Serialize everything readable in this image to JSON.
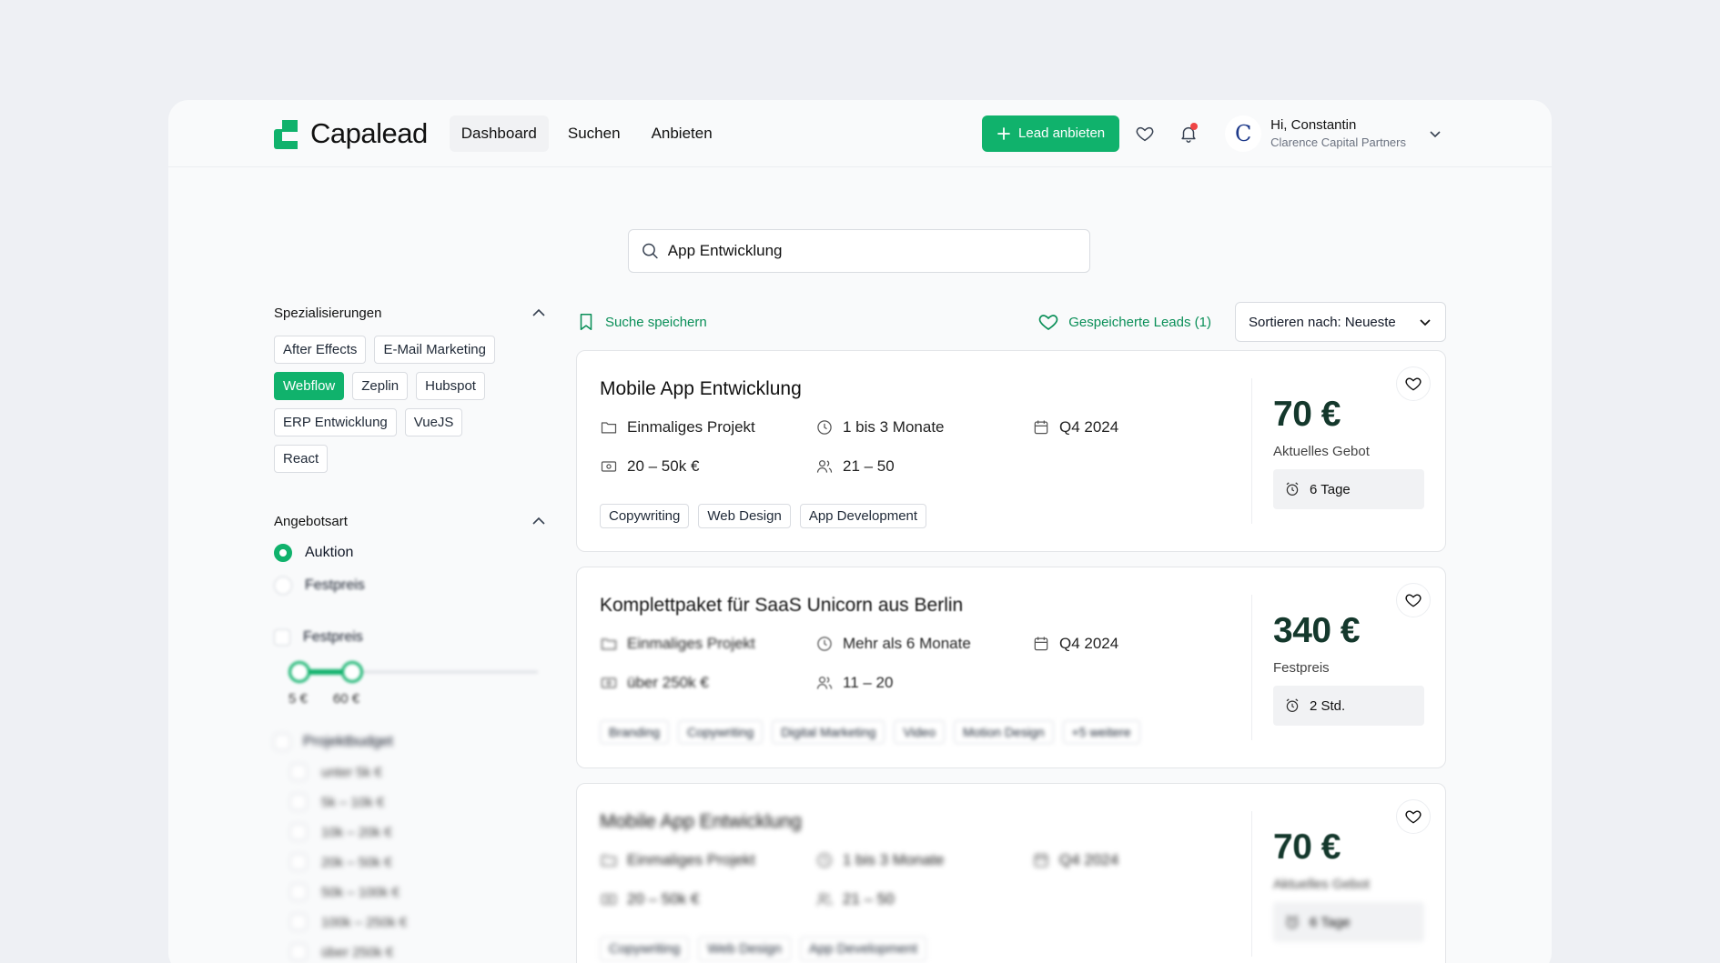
{
  "app": {
    "brand": "Capalead"
  },
  "nav": {
    "items": [
      "Dashboard",
      "Suchen",
      "Anbieten"
    ],
    "active": "Dashboard"
  },
  "header": {
    "cta_label": "Lead anbieten",
    "user_greeting": "Hi, Constantin",
    "user_company": "Clarence Capital Partners",
    "avatar_letter": "C"
  },
  "search": {
    "value": "App Entwicklung"
  },
  "sidebar": {
    "specializations": {
      "title": "Spezialisierungen",
      "tags": [
        "After Effects",
        "E-Mail Marketing",
        "Webflow",
        "Zeplin",
        "Hubspot",
        "ERP Entwicklung",
        "VueJS",
        "React"
      ],
      "selected": "Webflow"
    },
    "offer_type": {
      "title": "Angebotsart",
      "options": [
        "Auktion",
        "Festpreis"
      ],
      "selected": "Auktion"
    },
    "fixed_price": {
      "label": "Festpreis",
      "min_label": "5 €",
      "max_label": "60 €"
    },
    "project_budget": {
      "label": "Projektbudget",
      "options": [
        "unter 5k €",
        "5k – 10k €",
        "10k – 20k €",
        "20k – 50k €",
        "50k – 100k €",
        "100k – 250k €",
        "über 250k €"
      ]
    }
  },
  "toolbar": {
    "save_search": "Suche speichern",
    "saved_leads": "Gespeicherte Leads (1)",
    "sort_label": "Sortieren nach: Neueste"
  },
  "leads": [
    {
      "title": "Mobile App Entwicklung",
      "project_type": "Einmaliges Projekt",
      "duration": "1 bis 3 Monate",
      "quarter": "Q4 2024",
      "budget": "20 – 50k €",
      "team_size": "21 – 50",
      "tags": [
        "Copywriting",
        "Web Design",
        "App Development"
      ],
      "price": "70 €",
      "price_label": "Aktuelles Gebot",
      "time_left": "6 Tage"
    },
    {
      "title": "Komplettpaket für SaaS Unicorn aus Berlin",
      "project_type": "Einmaliges Projekt",
      "duration": "Mehr als 6 Monate",
      "quarter": "Q4 2024",
      "budget": "über 250k €",
      "team_size": "11 – 20",
      "tags": [
        "Branding",
        "Copywriting",
        "Digital Marketing",
        "Video",
        "Motion Design",
        "+5 weitere"
      ],
      "price": "340 €",
      "price_label": "Festpreis",
      "time_left": "2 Std."
    },
    {
      "title": "Mobile App Entwicklung",
      "project_type": "Einmaliges Projekt",
      "duration": "1 bis 3 Monate",
      "quarter": "Q4 2024",
      "budget": "20 – 50k €",
      "team_size": "21 – 50",
      "tags": [
        "Copywriting",
        "Web Design",
        "App Development"
      ],
      "price": "70 €",
      "price_label": "Aktuelles Gebot",
      "time_left": "6 Tage"
    }
  ],
  "colors": {
    "accent": "#10b26c",
    "price": "#14382c",
    "notification": "#ef4444"
  }
}
